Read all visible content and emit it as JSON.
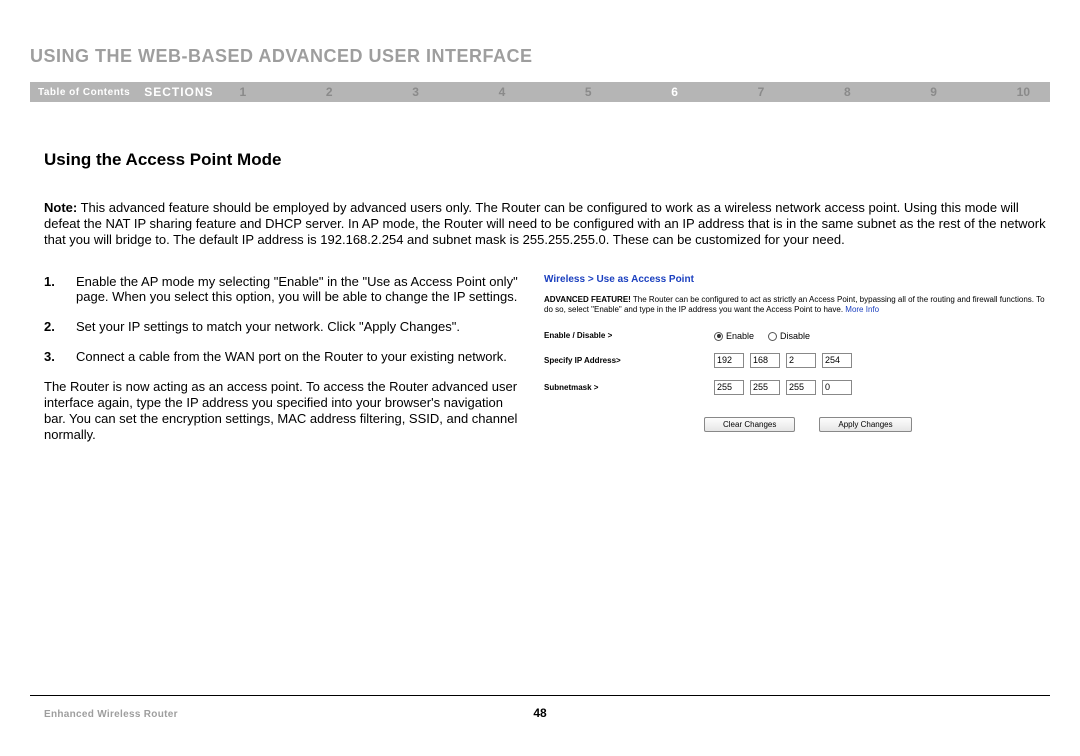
{
  "header": {
    "title": "USING THE WEB-BASED ADVANCED USER INTERFACE",
    "toc_label": "Table of Contents",
    "sections_label": "SECTIONS",
    "section_numbers": [
      "1",
      "2",
      "3",
      "4",
      "5",
      "6",
      "7",
      "8",
      "9",
      "10"
    ],
    "active_section": "6"
  },
  "main": {
    "heading": "Using the Access Point Mode",
    "note_label": "Note:",
    "note_body": " This advanced feature should be employed by advanced users only. The Router can be configured to work as a wireless network access point. Using this mode will defeat the NAT IP sharing feature and DHCP server. In AP mode, the Router will need to be configured with an IP address that is in the same subnet as the rest of the network that you will bridge to. The default IP address is 192.168.2.254 and subnet mask is 255.255.255.0. These can be customized for your need.",
    "steps": [
      "Enable the AP mode my selecting \"Enable\" in the \"Use as Access Point only\" page. When you select this option, you will be able to change the IP settings.",
      "Set your IP settings to match your network. Click \"Apply Changes\".",
      "Connect a cable from the WAN port on the Router to your existing network."
    ],
    "followup": "The Router is now acting as an access point. To access the Router advanced user interface again, type the IP address you specified into your browser's navigation bar. You can set the encryption settings, MAC address filtering, SSID, and channel normally."
  },
  "router_ui": {
    "breadcrumb": "Wireless > Use as Access Point",
    "adv_label": "ADVANCED FEATURE!",
    "adv_body": " The Router can be configured to act as strictly an Access Point, bypassing all of the routing and firewall functions. To do so, select \"Enable\" and type in the IP address you want the Access Point to have. ",
    "more_info": "More Info",
    "enable_label": "Enable / Disable >",
    "enable_option": "Enable",
    "disable_option": "Disable",
    "enable_checked": true,
    "ip_label": "Specify IP Address>",
    "ip": [
      "192",
      "168",
      "2",
      "254"
    ],
    "mask_label": "Subnetmask >",
    "mask": [
      "255",
      "255",
      "255",
      "0"
    ],
    "clear_btn": "Clear Changes",
    "apply_btn": "Apply Changes"
  },
  "footer": {
    "product": "Enhanced Wireless Router",
    "page": "48"
  }
}
